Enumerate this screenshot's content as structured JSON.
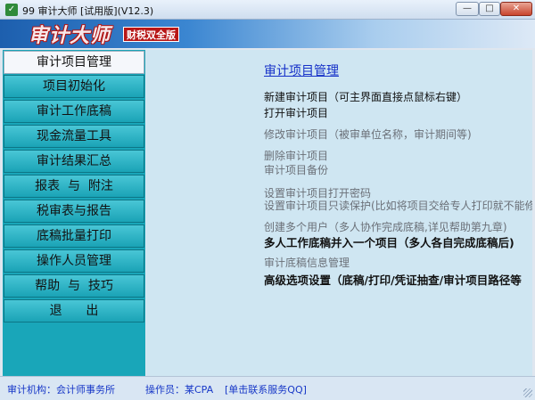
{
  "window": {
    "icon_text": "✓",
    "title": "99  审计大师 [试用版](V12.3)",
    "minimize": "—",
    "maximize": "□",
    "close": "✕"
  },
  "banner": {
    "logo": "审计大师",
    "badge": "财税双全版"
  },
  "sidebar": {
    "items": [
      {
        "label": "审计项目管理",
        "active": true
      },
      {
        "label": "项目初始化"
      },
      {
        "label": "审计工作底稿"
      },
      {
        "label": "现金流量工具"
      },
      {
        "label": "审计结果汇总"
      },
      {
        "label": "报表  与  附注"
      },
      {
        "label": "税审表与报告"
      },
      {
        "label": "底稿批量打印"
      },
      {
        "label": "操作人员管理"
      },
      {
        "label": "帮助  与  技巧"
      },
      {
        "label": "退      出"
      }
    ]
  },
  "main": {
    "title": "审计项目管理",
    "items": [
      {
        "label": "新建审计项目（可主界面直接点鼠标右键）",
        "state": "on"
      },
      {
        "label": "打开审计项目",
        "state": "on"
      },
      {
        "label": "修改审计项目（被审单位名称，审计期间等)",
        "state": "off"
      },
      {
        "label": "删除审计项目",
        "state": "off"
      },
      {
        "label": "审计项目备份",
        "state": "off"
      },
      {
        "label": "设置审计项目打开密码",
        "state": "off"
      },
      {
        "label": "设置审计项目只读保护(比如将项目交给专人打印就不能修",
        "state": "off"
      },
      {
        "label": "创建多个用户（多人协作完成底稿,详见帮助第九章)",
        "state": "off"
      },
      {
        "label": "多人工作底稿并入一个项目（多人各自完成底稿后)",
        "state": "bold"
      },
      {
        "label": "审计底稿信息管理",
        "state": "off"
      },
      {
        "label": "高级选项设置（底稿/打印/凭证抽查/审计项目路径等",
        "state": "bold"
      }
    ]
  },
  "status": {
    "org": "审计机构：会计师事务所",
    "operator": "操作员：某CPA",
    "qq_link": "[单击联系服务QQ]"
  }
}
